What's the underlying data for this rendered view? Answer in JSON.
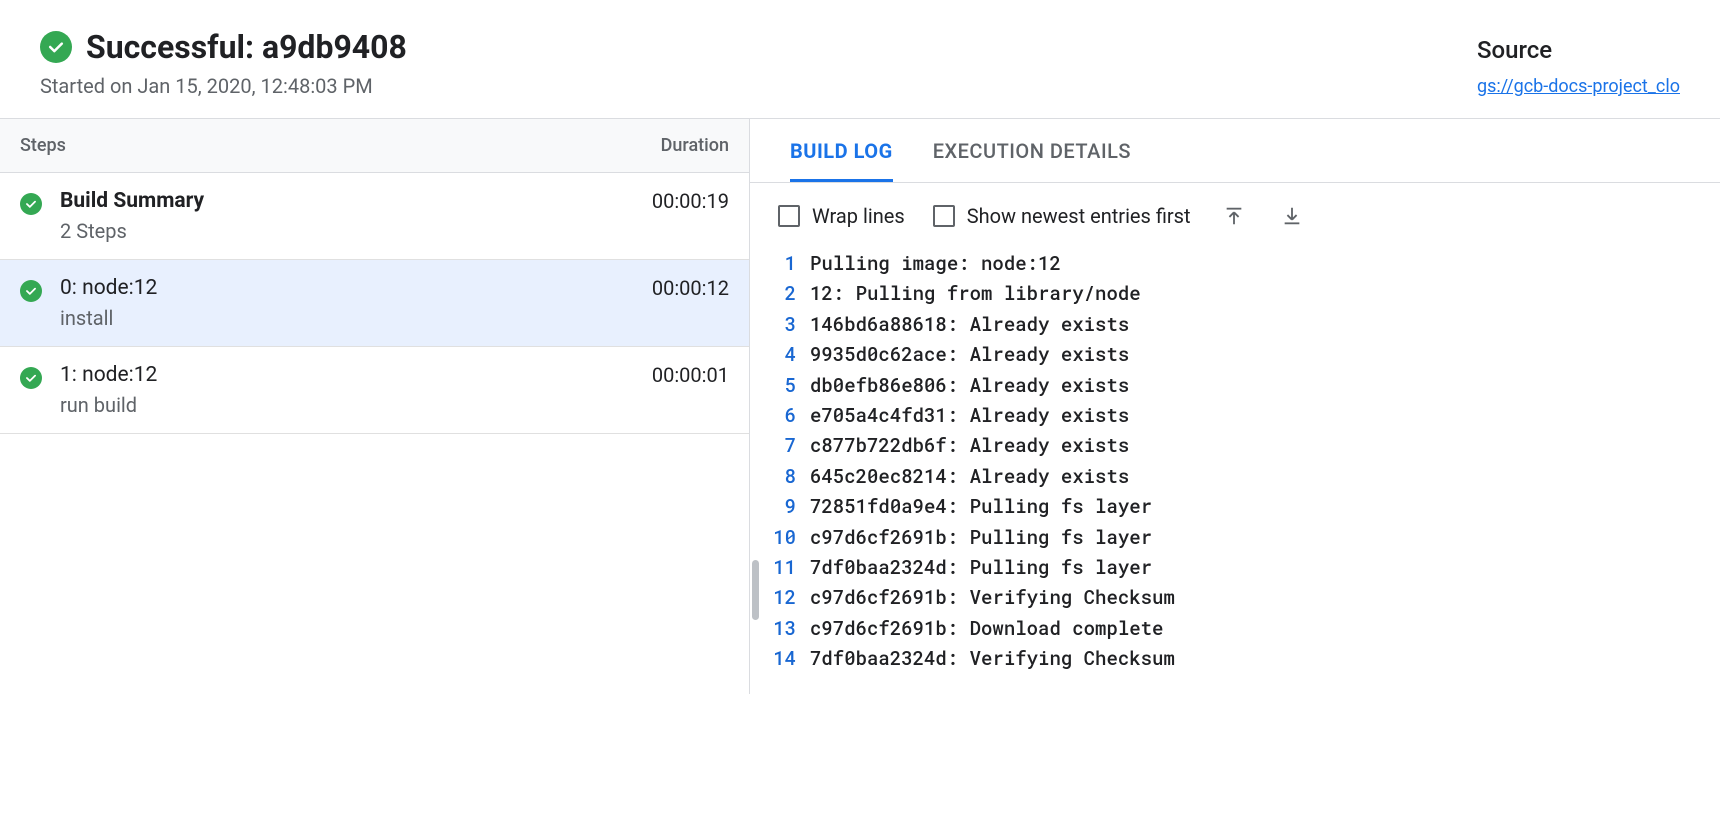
{
  "header": {
    "status_title": "Successful: a9db9408",
    "started": "Started on Jan 15, 2020, 12:48:03 PM",
    "source_label": "Source",
    "source_link": "gs://gcb-docs-project_clo"
  },
  "steps_panel": {
    "col_steps": "Steps",
    "col_duration": "Duration",
    "rows": [
      {
        "title": "Build Summary",
        "subtitle": "2 Steps",
        "duration": "00:00:19",
        "bold": true,
        "selected": false
      },
      {
        "title": "0: node:12",
        "subtitle": "install",
        "duration": "00:00:12",
        "bold": false,
        "selected": true
      },
      {
        "title": "1: node:12",
        "subtitle": "run build",
        "duration": "00:00:01",
        "bold": false,
        "selected": false
      }
    ]
  },
  "tabs": {
    "build_log": "BUILD LOG",
    "execution_details": "EXECUTION DETAILS"
  },
  "controls": {
    "wrap_lines": "Wrap lines",
    "newest_first": "Show newest entries first"
  },
  "log_lines": [
    "Pulling image: node:12",
    "12: Pulling from library/node",
    "146bd6a88618: Already exists",
    "9935d0c62ace: Already exists",
    "db0efb86e806: Already exists",
    "e705a4c4fd31: Already exists",
    "c877b722db6f: Already exists",
    "645c20ec8214: Already exists",
    "72851fd0a9e4: Pulling fs layer",
    "c97d6cf2691b: Pulling fs layer",
    "7df0baa2324d: Pulling fs layer",
    "c97d6cf2691b: Verifying Checksum",
    "c97d6cf2691b: Download complete",
    "7df0baa2324d: Verifying Checksum"
  ]
}
